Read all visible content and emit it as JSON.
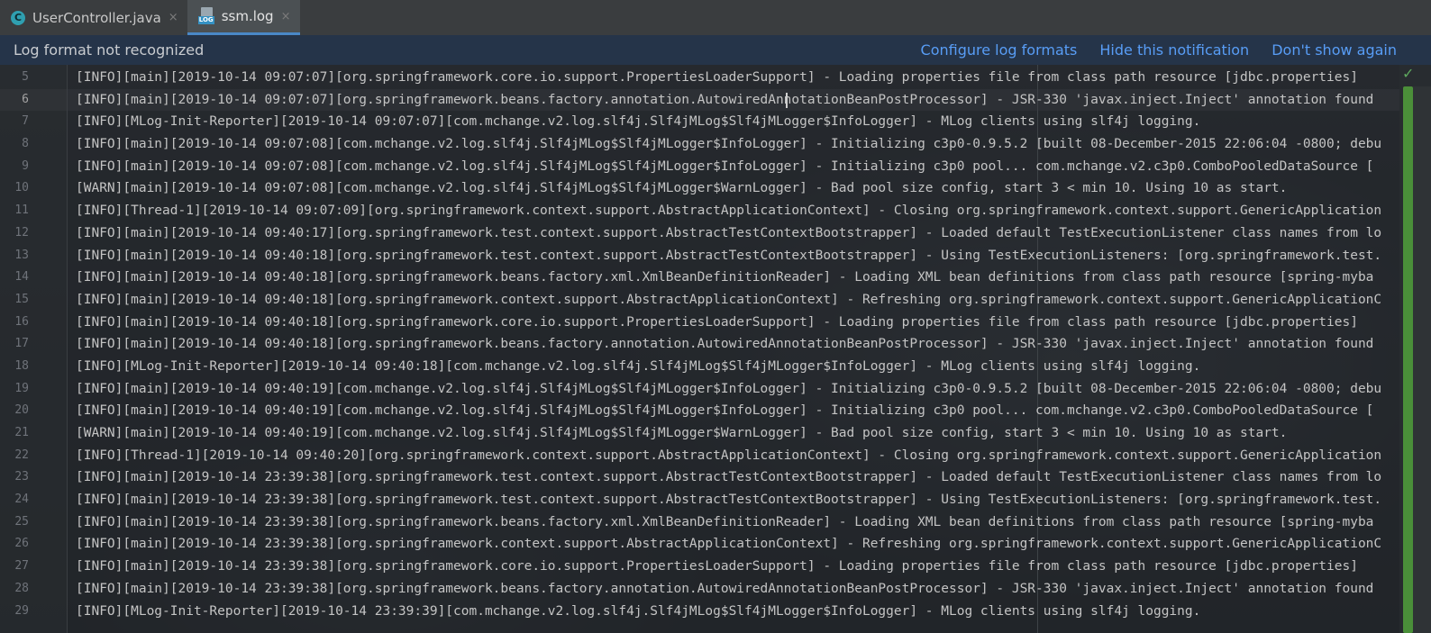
{
  "tabs": [
    {
      "label": "UserController.java",
      "icon": "java-class-icon",
      "icon_letter": "C",
      "active": false
    },
    {
      "label": "ssm.log",
      "icon": "log-file-icon",
      "icon_text": "LOG",
      "active": true
    }
  ],
  "tab_close_glyph": "×",
  "notification": {
    "message": "Log format not recognized",
    "links": [
      "Configure log formats",
      "Hide this notification",
      "Don't show again"
    ]
  },
  "editor": {
    "current_line": 6,
    "lines": [
      {
        "n": "5",
        "text": "[INFO][main][2019-10-14 09:07:07][org.springframework.core.io.support.PropertiesLoaderSupport] - Loading properties file from class path resource [jdbc.properties]"
      },
      {
        "n": "6",
        "text": "[INFO][main][2019-10-14 09:07:07][org.springframework.beans.factory.annotation.AutowiredAnnotationBeanPostProcessor] - JSR-330 'javax.inject.Inject' annotation found"
      },
      {
        "n": "7",
        "text": "[INFO][MLog-Init-Reporter][2019-10-14 09:07:07][com.mchange.v2.log.slf4j.Slf4jMLog$Slf4jMLogger$InfoLogger] - MLog clients using slf4j logging."
      },
      {
        "n": "8",
        "text": "[INFO][main][2019-10-14 09:07:08][com.mchange.v2.log.slf4j.Slf4jMLog$Slf4jMLogger$InfoLogger] - Initializing c3p0-0.9.5.2 [built 08-December-2015 22:06:04 -0800; debu"
      },
      {
        "n": "9",
        "text": "[INFO][main][2019-10-14 09:07:08][com.mchange.v2.log.slf4j.Slf4jMLog$Slf4jMLogger$InfoLogger] - Initializing c3p0 pool... com.mchange.v2.c3p0.ComboPooledDataSource ["
      },
      {
        "n": "10",
        "text": "[WARN][main][2019-10-14 09:07:08][com.mchange.v2.log.slf4j.Slf4jMLog$Slf4jMLogger$WarnLogger] - Bad pool size config, start 3 < min 10. Using 10 as start."
      },
      {
        "n": "11",
        "text": "[INFO][Thread-1][2019-10-14 09:07:09][org.springframework.context.support.AbstractApplicationContext] - Closing org.springframework.context.support.GenericApplication"
      },
      {
        "n": "12",
        "text": "[INFO][main][2019-10-14 09:40:17][org.springframework.test.context.support.AbstractTestContextBootstrapper] - Loaded default TestExecutionListener class names from lo"
      },
      {
        "n": "13",
        "text": "[INFO][main][2019-10-14 09:40:18][org.springframework.test.context.support.AbstractTestContextBootstrapper] - Using TestExecutionListeners: [org.springframework.test."
      },
      {
        "n": "14",
        "text": "[INFO][main][2019-10-14 09:40:18][org.springframework.beans.factory.xml.XmlBeanDefinitionReader] - Loading XML bean definitions from class path resource [spring-myba"
      },
      {
        "n": "15",
        "text": "[INFO][main][2019-10-14 09:40:18][org.springframework.context.support.AbstractApplicationContext] - Refreshing org.springframework.context.support.GenericApplicationC"
      },
      {
        "n": "16",
        "text": "[INFO][main][2019-10-14 09:40:18][org.springframework.core.io.support.PropertiesLoaderSupport] - Loading properties file from class path resource [jdbc.properties]"
      },
      {
        "n": "17",
        "text": "[INFO][main][2019-10-14 09:40:18][org.springframework.beans.factory.annotation.AutowiredAnnotationBeanPostProcessor] - JSR-330 'javax.inject.Inject' annotation found"
      },
      {
        "n": "18",
        "text": "[INFO][MLog-Init-Reporter][2019-10-14 09:40:18][com.mchange.v2.log.slf4j.Slf4jMLog$Slf4jMLogger$InfoLogger] - MLog clients using slf4j logging."
      },
      {
        "n": "19",
        "text": "[INFO][main][2019-10-14 09:40:19][com.mchange.v2.log.slf4j.Slf4jMLog$Slf4jMLogger$InfoLogger] - Initializing c3p0-0.9.5.2 [built 08-December-2015 22:06:04 -0800; debu"
      },
      {
        "n": "20",
        "text": "[INFO][main][2019-10-14 09:40:19][com.mchange.v2.log.slf4j.Slf4jMLog$Slf4jMLogger$InfoLogger] - Initializing c3p0 pool... com.mchange.v2.c3p0.ComboPooledDataSource ["
      },
      {
        "n": "21",
        "text": "[WARN][main][2019-10-14 09:40:19][com.mchange.v2.log.slf4j.Slf4jMLog$Slf4jMLogger$WarnLogger] - Bad pool size config, start 3 < min 10. Using 10 as start."
      },
      {
        "n": "22",
        "text": "[INFO][Thread-1][2019-10-14 09:40:20][org.springframework.context.support.AbstractApplicationContext] - Closing org.springframework.context.support.GenericApplication"
      },
      {
        "n": "23",
        "text": "[INFO][main][2019-10-14 23:39:38][org.springframework.test.context.support.AbstractTestContextBootstrapper] - Loaded default TestExecutionListener class names from lo"
      },
      {
        "n": "24",
        "text": "[INFO][main][2019-10-14 23:39:38][org.springframework.test.context.support.AbstractTestContextBootstrapper] - Using TestExecutionListeners: [org.springframework.test."
      },
      {
        "n": "25",
        "text": "[INFO][main][2019-10-14 23:39:38][org.springframework.beans.factory.xml.XmlBeanDefinitionReader] - Loading XML bean definitions from class path resource [spring-myba"
      },
      {
        "n": "26",
        "text": "[INFO][main][2019-10-14 23:39:38][org.springframework.context.support.AbstractApplicationContext] - Refreshing org.springframework.context.support.GenericApplicationC"
      },
      {
        "n": "27",
        "text": "[INFO][main][2019-10-14 23:39:38][org.springframework.core.io.support.PropertiesLoaderSupport] - Loading properties file from class path resource [jdbc.properties]"
      },
      {
        "n": "28",
        "text": "[INFO][main][2019-10-14 23:39:38][org.springframework.beans.factory.annotation.AutowiredAnnotationBeanPostProcessor] - JSR-330 'javax.inject.Inject' annotation found"
      },
      {
        "n": "29",
        "text": "[INFO][MLog-Init-Reporter][2019-10-14 23:39:39][com.mchange.v2.log.slf4j.Slf4jMLog$Slf4jMLogger$InfoLogger] - MLog clients using slf4j logging."
      }
    ]
  },
  "inspection_status": {
    "icon": "check-icon",
    "glyph": "✓"
  },
  "colors": {
    "accent": "#4a88c7",
    "link": "#589df6",
    "notification_bg": "#253449",
    "scrollbar": "#4f9a3b"
  }
}
